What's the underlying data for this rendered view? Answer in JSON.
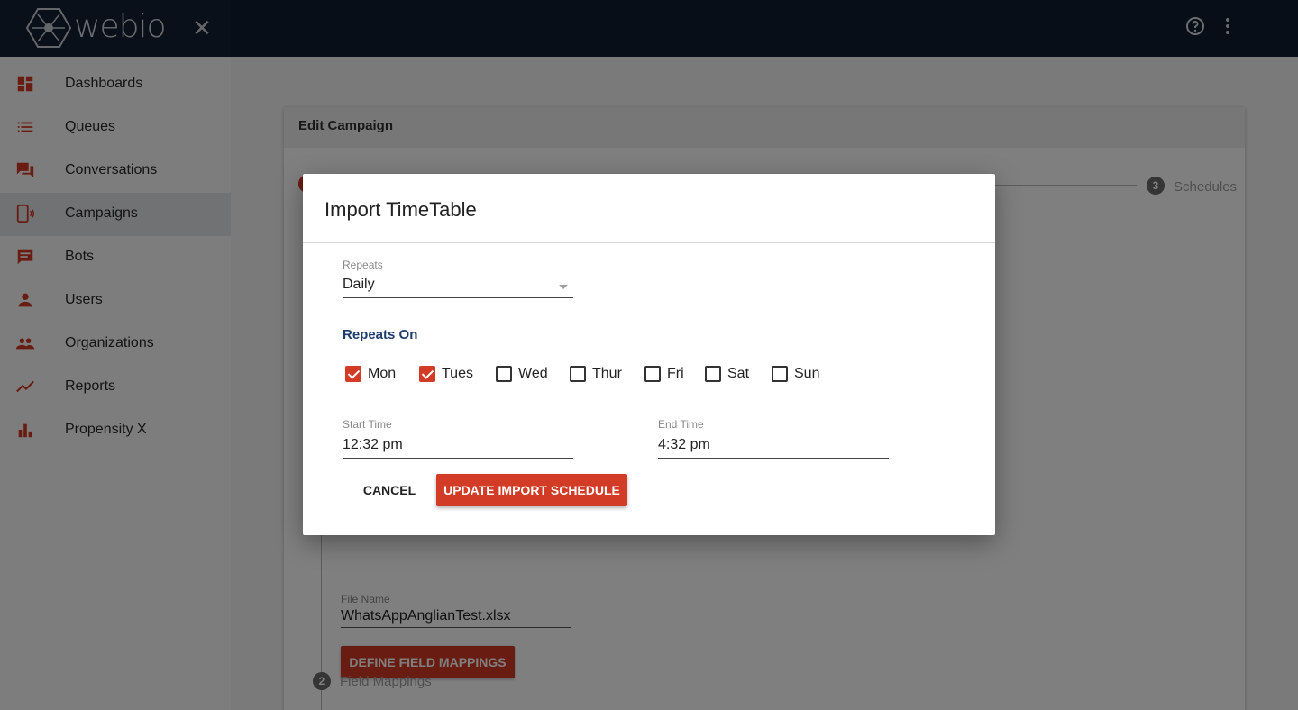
{
  "app": {
    "brand": "webio"
  },
  "colors": {
    "accent": "#d23b25",
    "topbar": "#0f1c2e",
    "section_title": "#1f3d6b"
  },
  "topbar": {
    "icons": [
      "help-icon",
      "more-vert-icon"
    ]
  },
  "sidebar": {
    "items": [
      {
        "label": "Dashboards",
        "icon": "dashboard-icon"
      },
      {
        "label": "Queues",
        "icon": "list-icon"
      },
      {
        "label": "Conversations",
        "icon": "forum-icon"
      },
      {
        "label": "Campaigns",
        "icon": "campaign-icon",
        "active": true
      },
      {
        "label": "Bots",
        "icon": "chat-icon"
      },
      {
        "label": "Users",
        "icon": "person-icon"
      },
      {
        "label": "Organizations",
        "icon": "group-icon"
      },
      {
        "label": "Reports",
        "icon": "trending-icon"
      },
      {
        "label": "Propensity X",
        "icon": "bar-chart-icon"
      }
    ]
  },
  "page": {
    "card_title": "Edit Campaign",
    "stepper": {
      "step3": {
        "number": "3",
        "label": "Schedules"
      },
      "step2": {
        "number": "2",
        "label": "Field Mappings"
      }
    },
    "file_name_label": "File Name",
    "file_name_value": "WhatsAppAnglianTest.xlsx",
    "define_mappings_label": "DEFINE FIELD MAPPINGS"
  },
  "dialog": {
    "title": "Import TimeTable",
    "repeats": {
      "label": "Repeats",
      "value": "Daily"
    },
    "repeats_on_title": "Repeats On",
    "days": [
      {
        "label": "Mon",
        "checked": true
      },
      {
        "label": "Tues",
        "checked": true
      },
      {
        "label": "Wed",
        "checked": false
      },
      {
        "label": "Thur",
        "checked": false
      },
      {
        "label": "Fri",
        "checked": false
      },
      {
        "label": "Sat",
        "checked": false
      },
      {
        "label": "Sun",
        "checked": false
      }
    ],
    "start_time": {
      "label": "Start Time",
      "value": "12:32 pm"
    },
    "end_time": {
      "label": "End Time",
      "value": "4:32 pm"
    },
    "cancel_label": "CANCEL",
    "update_label": "UPDATE IMPORT SCHEDULE"
  }
}
